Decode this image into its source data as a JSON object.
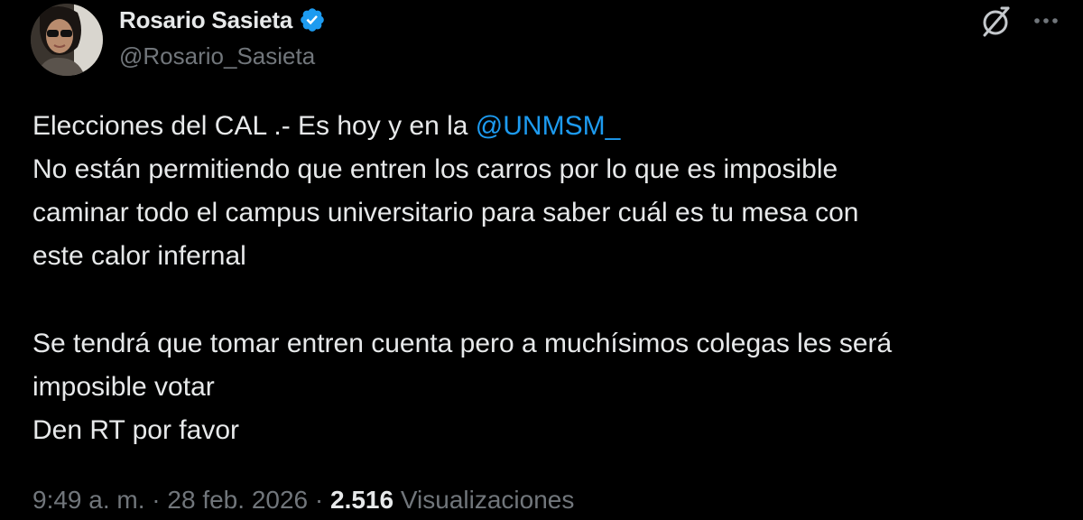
{
  "author": {
    "display_name": "Rosario Sasieta",
    "handle": "@Rosario_Sasieta",
    "verified": true
  },
  "tweet": {
    "line1_text": "Elecciones del CAL .-  Es hoy y en la ",
    "mention": "@UNMSM_",
    "line2": "No están permitiendo que entren los carros por lo que es imposible",
    "line3": "caminar todo el campus universitario para saber cuál es tu mesa con",
    "line4": "este calor infernal",
    "line5": "Se tendrá que tomar entren cuenta pero a muchísimos colegas les será",
    "line6": "imposible votar",
    "line7": "Den RT por favor"
  },
  "meta": {
    "time": "9:49 a. m.",
    "separator": " · ",
    "date": "28 feb. 2026",
    "views_count": "2.516",
    "views_label": "Visualizaciones"
  },
  "colors": {
    "background": "#000000",
    "text": "#e7e9ea",
    "secondary": "#71767b",
    "accent": "#1d9bf0"
  },
  "icons": {
    "verified": "verified-badge-icon",
    "grok": "grok-icon",
    "more": "more-options-icon"
  }
}
